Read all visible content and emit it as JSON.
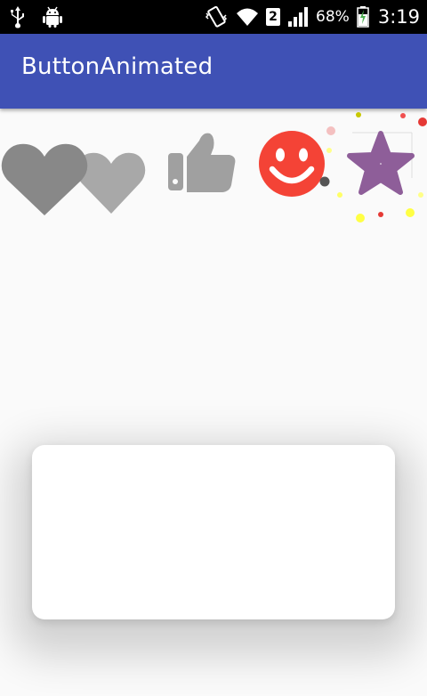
{
  "status_bar": {
    "sim_slot": "2",
    "battery_percent": "68%",
    "time": "3:19",
    "icons": [
      "usb-icon",
      "android-icon",
      "vibrate-icon",
      "wifi-icon",
      "sim-icon",
      "signal-icon",
      "battery-charging-icon"
    ]
  },
  "app_bar": {
    "title": "ButtonAnimated",
    "color": "#3f51b5"
  },
  "buttons": [
    {
      "name": "heart-button",
      "icon": "heart-icon",
      "color": "#888888"
    },
    {
      "name": "thumb-up-button",
      "icon": "thumb-up-icon",
      "color": "#a0a0a0"
    },
    {
      "name": "smile-button",
      "icon": "smile-icon",
      "color": "#f44336"
    },
    {
      "name": "star-button",
      "icon": "star-icon",
      "color": "#8e5e99"
    }
  ],
  "card": {
    "color": "#ffffff"
  }
}
